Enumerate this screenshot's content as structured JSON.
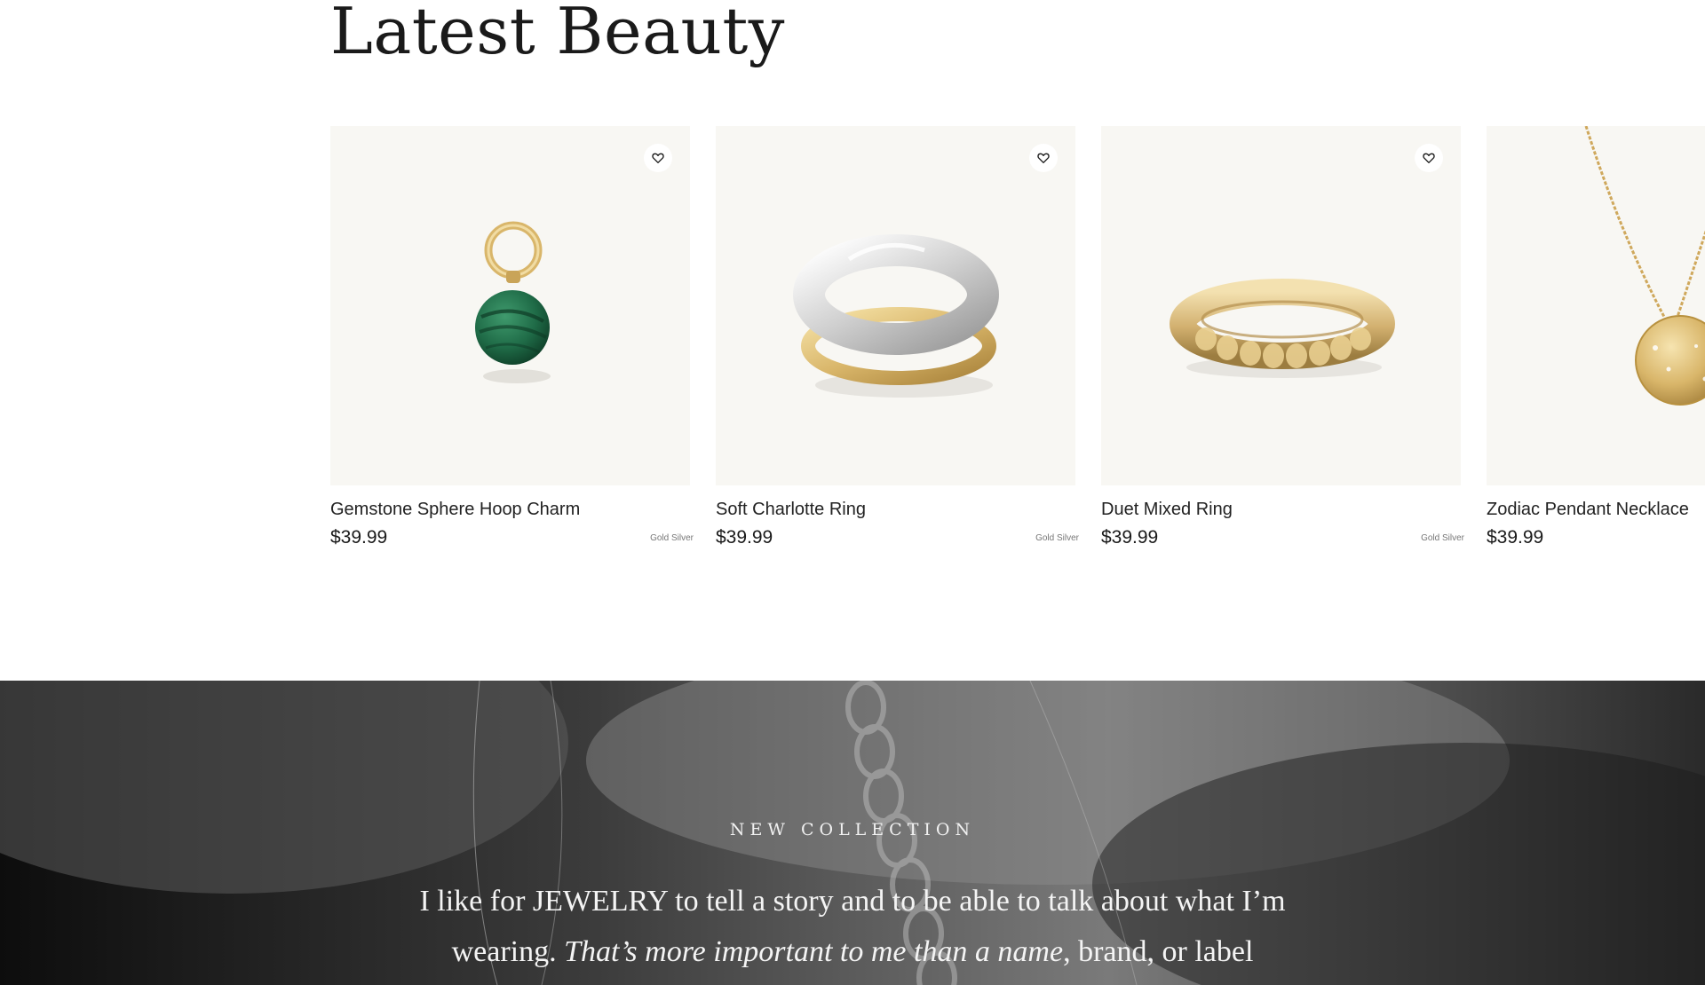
{
  "section": {
    "title": "Latest Beauty"
  },
  "products": [
    {
      "name": "Gemstone Sphere Hoop Charm",
      "price": "$39.99",
      "variants": "Gold Silver",
      "wishlist_icon": "heart-outline-icon"
    },
    {
      "name": "Soft Charlotte Ring",
      "price": "$39.99",
      "variants": "Gold Silver",
      "wishlist_icon": "heart-outline-icon"
    },
    {
      "name": "Duet Mixed Ring",
      "price": "$39.99",
      "variants": "Gold Silver",
      "wishlist_icon": "heart-outline-icon"
    },
    {
      "name": "Zodiac Pendant Necklace",
      "price": "$39.99"
    }
  ],
  "hero": {
    "eyebrow": "NEW COLLECTION",
    "quote_part1": "I like for JEWELRY to tell a story and to be able to talk about what I’m wearing. ",
    "quote_italic": "That’s more important to me than a name",
    "quote_part2": ", brand, or label"
  },
  "colors": {
    "card_background": "#f8f7f3",
    "gold": "#d9b66a",
    "silver": "#d8d8d8",
    "malachite": "#1f6b47",
    "hero_dark": "#2b2b2b"
  }
}
